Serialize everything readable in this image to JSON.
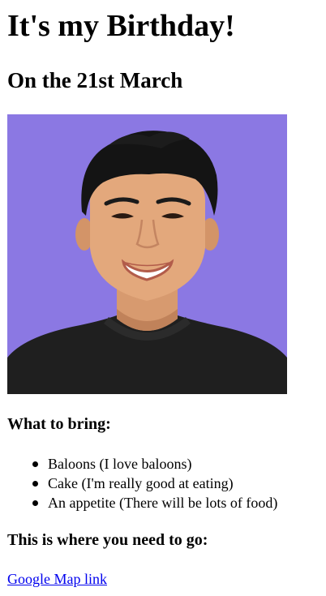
{
  "header": {
    "title": "It's my Birthday!",
    "subtitle": "On the 21st March"
  },
  "photo": {
    "description_icon": "portrait-photo",
    "background_color": "#8b78e3"
  },
  "bring": {
    "heading": "What to bring:",
    "items": [
      "Baloons (I love baloons)",
      "Cake (I'm really good at eating)",
      "An appetite (There will be lots of food)"
    ]
  },
  "location": {
    "heading": "This is where you need to go:",
    "link_text": "Google Map link",
    "link_color": "#0000ee"
  }
}
